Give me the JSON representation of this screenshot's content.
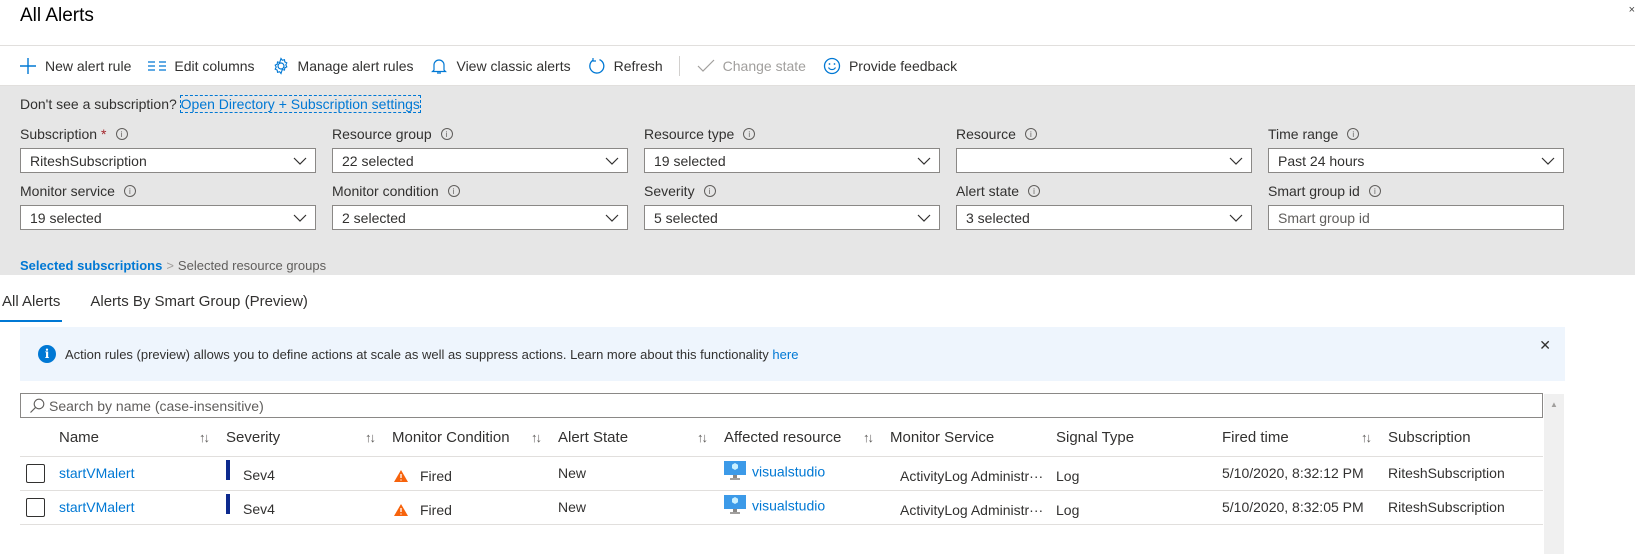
{
  "header": {
    "title": "All Alerts",
    "corner_glyph": "×"
  },
  "toolbar": {
    "items": [
      {
        "label": "New alert rule",
        "icon": "plus-icon"
      },
      {
        "label": "Edit columns",
        "icon": "columns-icon"
      },
      {
        "label": "Manage alert rules",
        "icon": "gear-icon"
      },
      {
        "label": "View classic alerts",
        "icon": "bell-icon"
      },
      {
        "label": "Refresh",
        "icon": "refresh-icon"
      },
      {
        "label": "Change state",
        "icon": "check-icon",
        "disabled": true
      },
      {
        "label": "Provide feedback",
        "icon": "smiley-icon"
      }
    ]
  },
  "filters": {
    "note_text": "Don't see a subscription? ",
    "note_link": "Open Directory + Subscription settings",
    "fields": [
      {
        "label": "Subscription",
        "required_mark": "*",
        "value": "RiteshSubscription",
        "type": "select"
      },
      {
        "label": "Resource group",
        "value": "22 selected",
        "type": "select"
      },
      {
        "label": "Resource type",
        "value": "19 selected",
        "type": "select"
      },
      {
        "label": "Resource",
        "value": "",
        "type": "select"
      },
      {
        "label": "Time range",
        "value": "Past 24 hours",
        "type": "select"
      },
      {
        "label": "Monitor service",
        "value": "19 selected",
        "type": "select"
      },
      {
        "label": "Monitor condition",
        "value": "2 selected",
        "type": "select"
      },
      {
        "label": "Severity",
        "value": "5 selected",
        "type": "select"
      },
      {
        "label": "Alert state",
        "value": "3 selected",
        "type": "select"
      },
      {
        "label": "Smart group id",
        "value": "",
        "placeholder": "Smart group id",
        "type": "text"
      }
    ],
    "info_glyph": "i",
    "breadcrumb": {
      "active": "Selected subscriptions",
      "separator": ">",
      "inactive": "Selected resource groups"
    }
  },
  "tabs": [
    {
      "label": "All Alerts",
      "active": true
    },
    {
      "label": "Alerts By Smart Group (Preview)",
      "active": false
    }
  ],
  "banner": {
    "info_glyph": "i",
    "text": "Action rules (preview) allows you to define actions at scale as well as suppress actions. Learn more about this functionality ",
    "link": "here",
    "close_glyph": "✕"
  },
  "search": {
    "placeholder": "Search by name (case-insensitive)",
    "value": ""
  },
  "table": {
    "sort_glyph": "↑↓",
    "columns": [
      {
        "label": "Name",
        "sortable": true
      },
      {
        "label": "Severity",
        "sortable": true
      },
      {
        "label": "Monitor Condition",
        "sortable": true
      },
      {
        "label": "Alert State",
        "sortable": true
      },
      {
        "label": "Affected resource",
        "sortable": true
      },
      {
        "label": "Monitor Service",
        "sortable": false
      },
      {
        "label": "Signal Type",
        "sortable": false
      },
      {
        "label": "Fired time",
        "sortable": true
      },
      {
        "label": "Subscription",
        "sortable": false
      }
    ],
    "rows": [
      {
        "name": "startVMalert",
        "severity": "Sev4",
        "monitor_condition": "Fired",
        "alert_state": "New",
        "affected_resource": "visualstudio",
        "monitor_service": "ActivityLog Administr···",
        "signal_type": "Log",
        "fired_time": "5/10/2020, 8:32:12 PM",
        "subscription": "RiteshSubscription"
      },
      {
        "name": "startVMalert",
        "severity": "Sev4",
        "monitor_condition": "Fired",
        "alert_state": "New",
        "affected_resource": "visualstudio",
        "monitor_service": "ActivityLog Administr···",
        "signal_type": "Log",
        "fired_time": "5/10/2020, 8:32:05 PM",
        "subscription": "RiteshSubscription"
      }
    ]
  },
  "colors": {
    "accent": "#0078d4",
    "severity_sev4": "#0d2a8e",
    "warning": "#f7630c",
    "filter_bg": "#e6e6e6",
    "banner_bg": "#eef5fd"
  }
}
